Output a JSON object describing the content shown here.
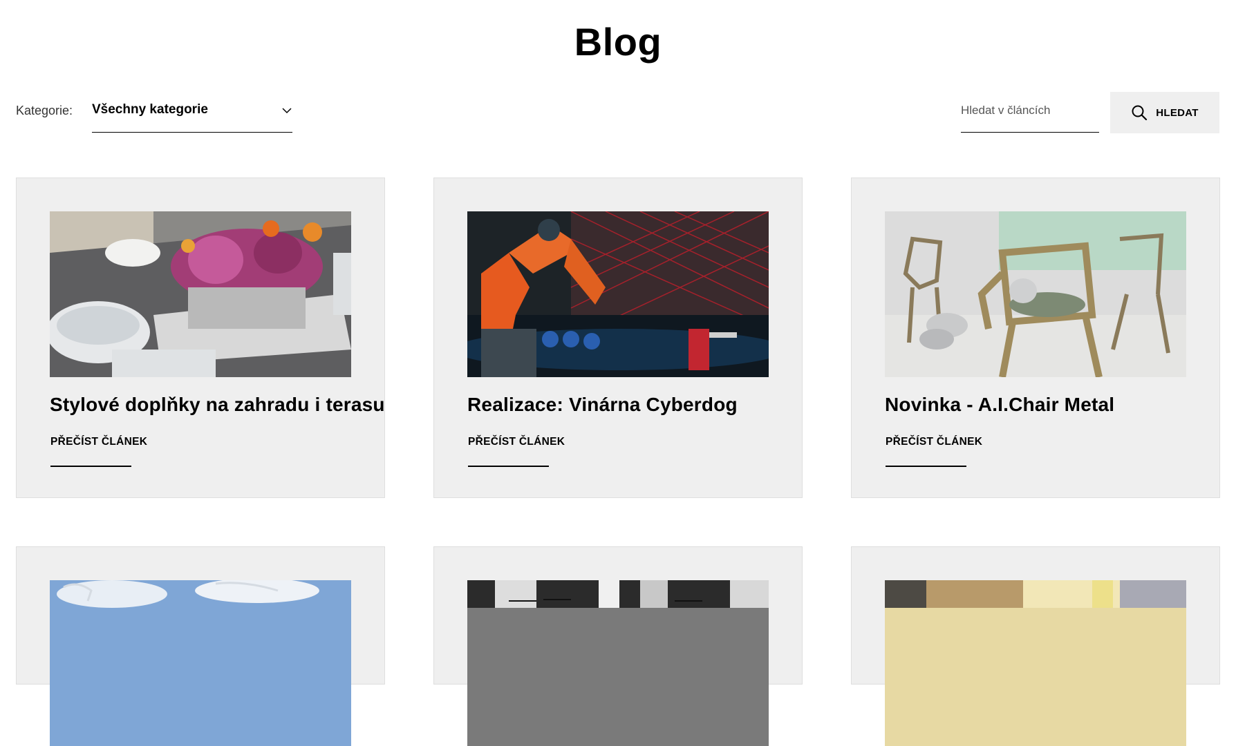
{
  "page": {
    "title": "Blog"
  },
  "filters": {
    "category_label": "Kategorie:",
    "category_value": "Všechny kategorie",
    "search_placeholder": "Hledat v článcích",
    "search_button_label": "HLEDAT"
  },
  "articles": [
    {
      "title": "Stylové doplňky na zahradu i terasu",
      "link_label": "PŘEČÍST ČLÁNEK"
    },
    {
      "title": "Realizace: Vinárna Cyberdog",
      "link_label": "PŘEČÍST ČLÁNEK"
    },
    {
      "title": "Novinka - A.I.Chair Metal",
      "link_label": "PŘEČÍST ČLÁNEK"
    }
  ],
  "colors": {
    "card_background": "#efefef",
    "button_background": "#efefef",
    "text": "#000000"
  }
}
